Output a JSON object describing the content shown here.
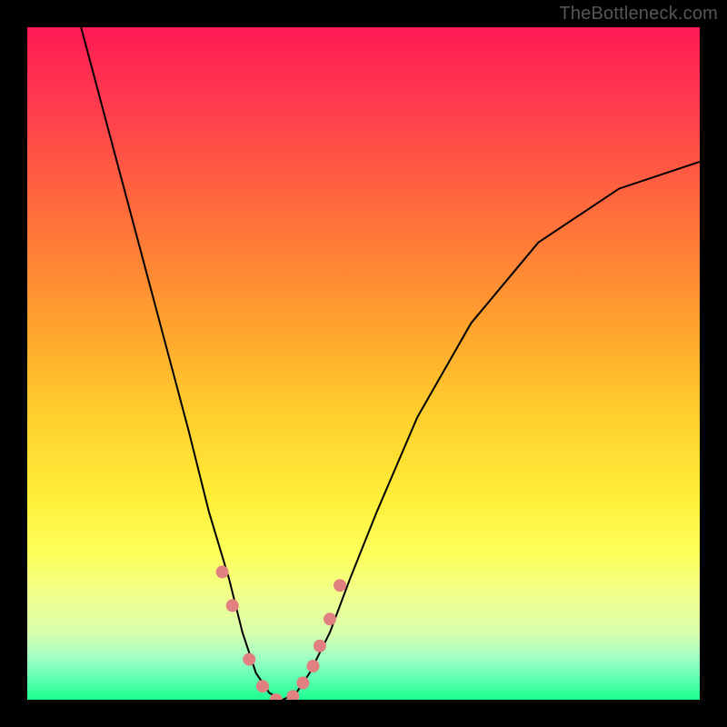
{
  "watermark": "TheBottleneck.com",
  "chart_data": {
    "type": "line",
    "title": "",
    "xlabel": "",
    "ylabel": "",
    "xlim": [
      0,
      100
    ],
    "ylim": [
      0,
      100
    ],
    "series": [
      {
        "name": "bottleneck-curve",
        "x": [
          8,
          12,
          16,
          20,
          24,
          27,
          30,
          32,
          34,
          36,
          38,
          40,
          42,
          45,
          48,
          52,
          58,
          66,
          76,
          88,
          100
        ],
        "values": [
          100,
          85,
          70,
          55,
          40,
          28,
          18,
          10,
          4,
          1,
          0,
          1,
          4,
          10,
          18,
          28,
          42,
          56,
          68,
          76,
          80
        ]
      }
    ],
    "markers": {
      "name": "highlight-dots",
      "x": [
        29,
        30.5,
        33,
        35,
        37,
        39.5,
        41,
        42.5,
        43.5,
        45,
        46.5
      ],
      "values": [
        19,
        14,
        6,
        2,
        0,
        0.5,
        2.5,
        5,
        8,
        12,
        17
      ]
    },
    "background_gradient": {
      "top": "#ff1a54",
      "mid": "#ffee3a",
      "bottom": "#1cff91"
    }
  }
}
